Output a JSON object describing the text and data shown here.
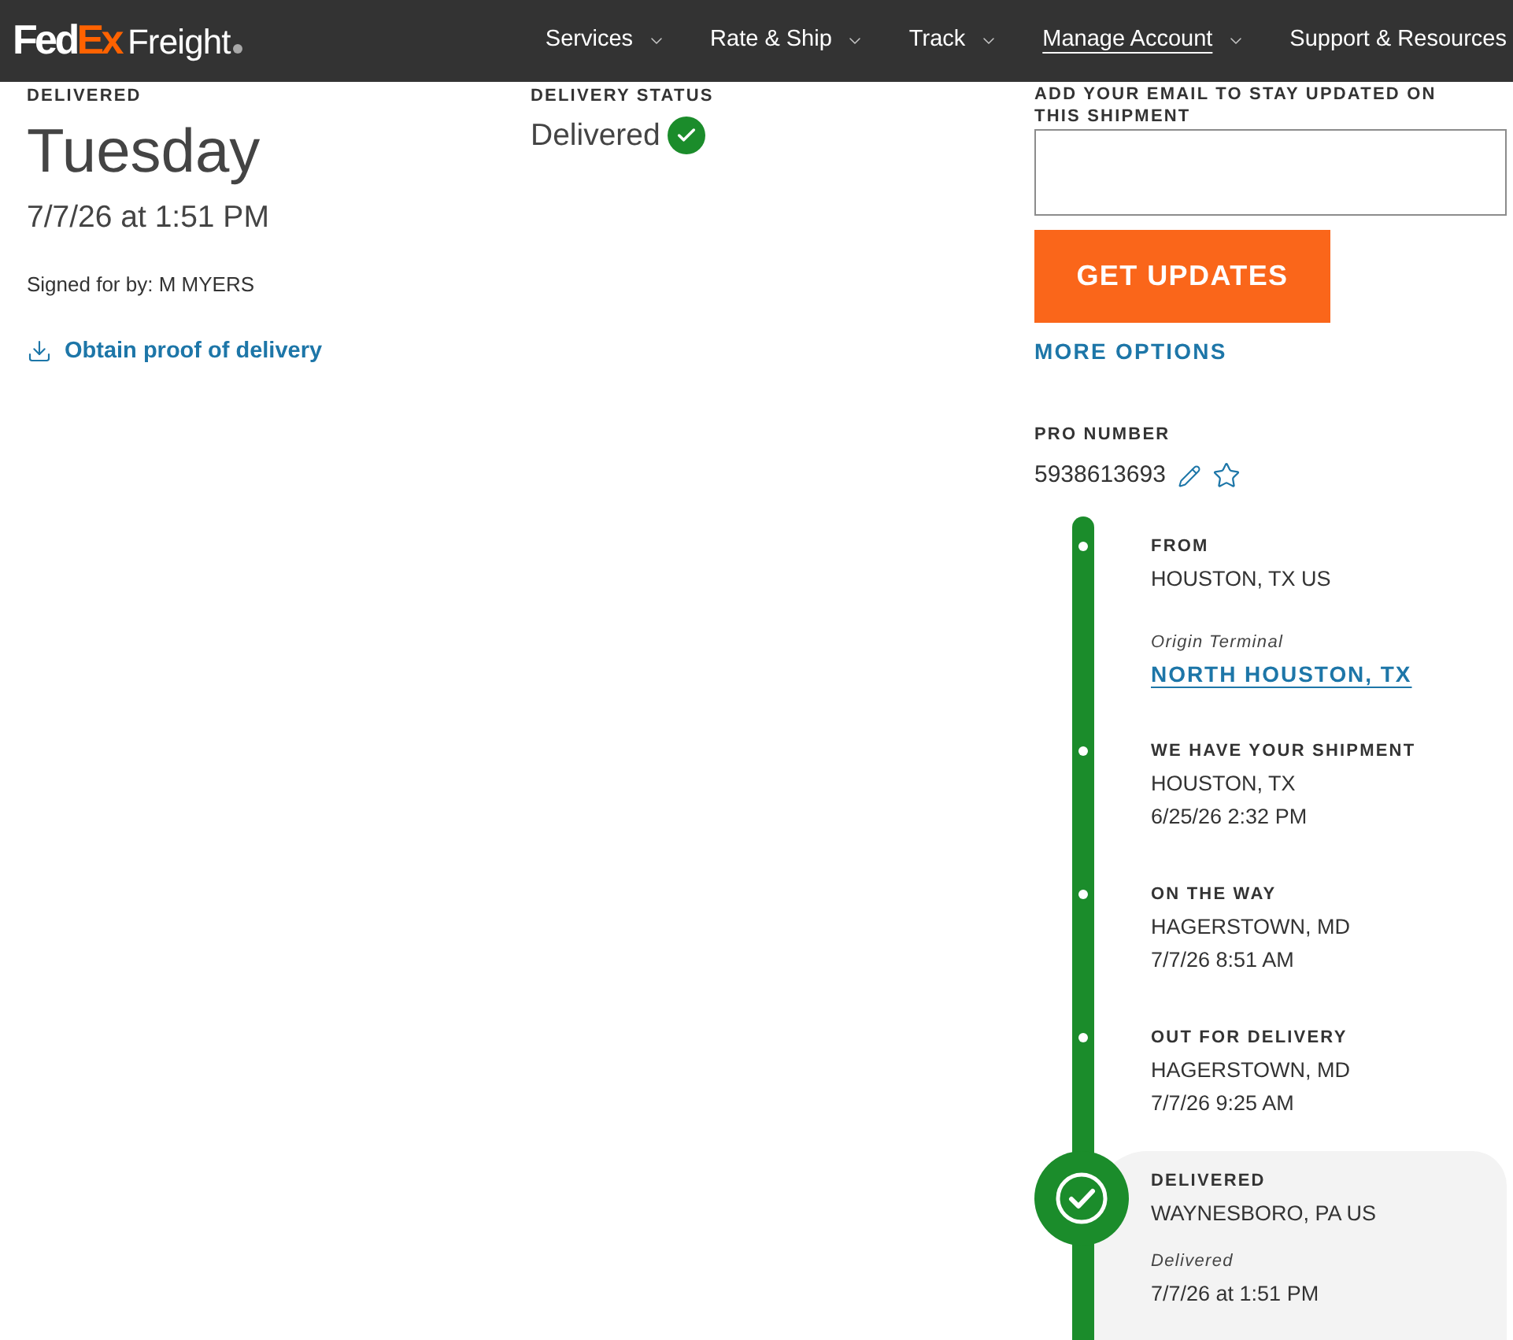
{
  "header": {
    "logo": {
      "primary": "Fed",
      "accent": "Ex",
      "product": "Freight"
    },
    "nav": [
      {
        "label": "Services",
        "has_menu": true,
        "selected": false
      },
      {
        "label": "Rate & Ship",
        "has_menu": true,
        "selected": false
      },
      {
        "label": "Track",
        "has_menu": true,
        "selected": false
      },
      {
        "label": "Manage Account",
        "has_menu": true,
        "selected": true
      },
      {
        "label": "Support & Resources",
        "has_menu": false,
        "selected": false
      }
    ]
  },
  "delivery": {
    "label": "DELIVERED",
    "day": "Tuesday",
    "datetime": "7/7/26 at 1:51 PM",
    "signed_for": "Signed for by: M MYERS",
    "proof_link": "Obtain proof of delivery"
  },
  "status": {
    "label": "DELIVERY STATUS",
    "value": "Delivered",
    "complete": true
  },
  "updates": {
    "label": "ADD YOUR EMAIL TO STAY UPDATED ON THIS SHIPMENT",
    "button": "GET UPDATES",
    "more_link": "MORE OPTIONS"
  },
  "pro_number": {
    "label": "PRO NUMBER",
    "value": "5938613693",
    "favorite": false
  },
  "timeline": {
    "events": [
      {
        "title": "FROM",
        "location": "HOUSTON, TX US",
        "terminal": {
          "label": "Origin Terminal",
          "link": "NORTH HOUSTON, TX"
        },
        "current": false
      },
      {
        "title": "WE HAVE YOUR SHIPMENT",
        "location": "HOUSTON, TX",
        "time": "6/25/26 2:32 PM",
        "current": false
      },
      {
        "title": "ON THE WAY",
        "location": "HAGERSTOWN, MD",
        "time": "7/7/26 8:51 AM",
        "current": false
      },
      {
        "title": "OUT FOR DELIVERY",
        "location": "HAGERSTOWN, MD",
        "time": "7/7/26 9:25 AM",
        "current": false
      },
      {
        "title": "DELIVERED",
        "location": "WAYNESBORO, PA US",
        "detail": {
          "label": "Delivered",
          "value": "7/7/26 at 1:51 PM"
        },
        "current": true
      }
    ]
  }
}
